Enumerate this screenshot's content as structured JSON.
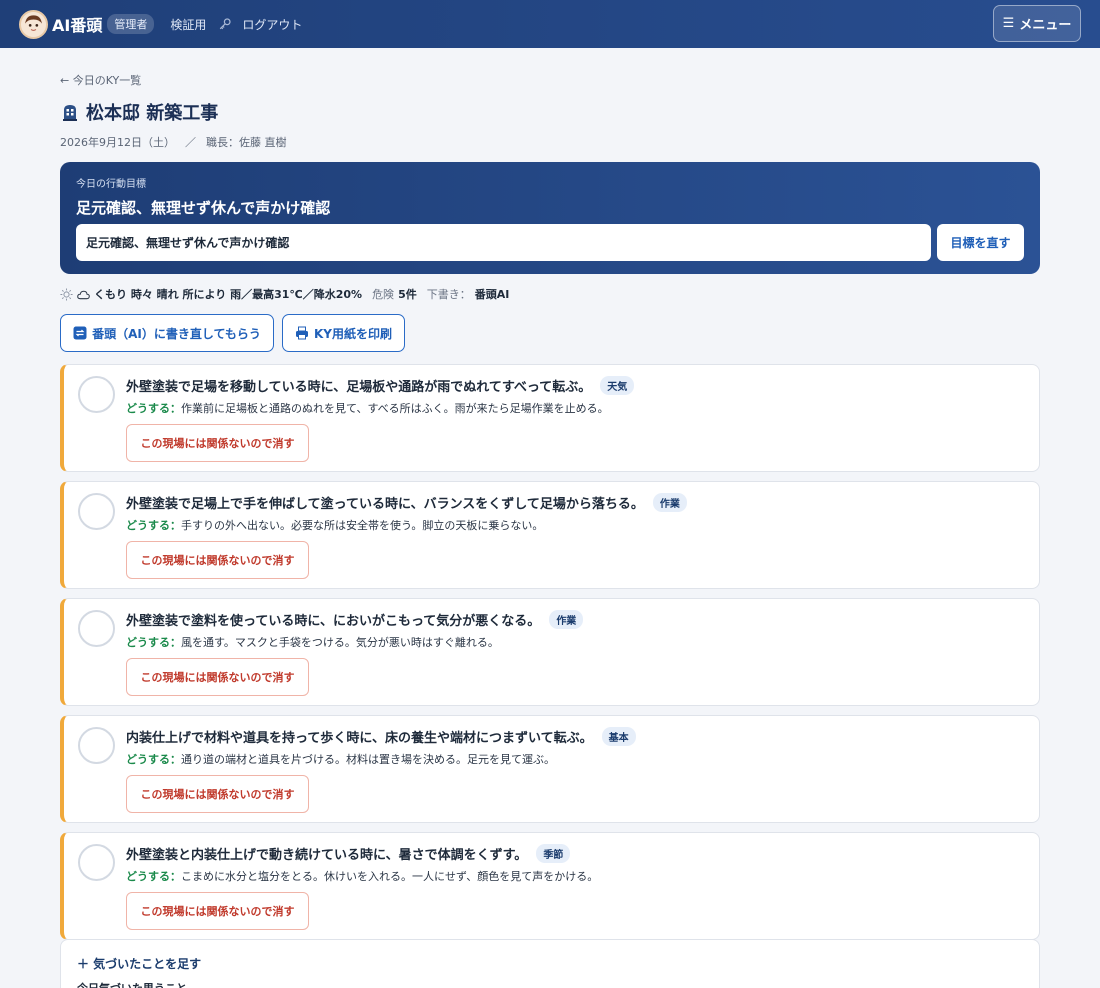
{
  "header": {
    "brand": "AI番頭",
    "role_badge": "管理者",
    "nav_link": "検証用",
    "logout": "ログアウト",
    "menu_label": "メニュー"
  },
  "page": {
    "back_link": "← 今日のKY一覧",
    "title": "松本邸 新築工事",
    "date": "2026年9月12日（土）",
    "separator": "／",
    "foreman": "職長：佐藤 直樹"
  },
  "goal": {
    "label": "今日の行動目標",
    "text": "足元確認、無理せず休んで声かけ確認",
    "input_value": "足元確認、無理せず休んで声かけ確認",
    "button_label": "目標を直す"
  },
  "weather": {
    "summary": "くもり 時々 晴れ 所により 雨／最高31℃／降水20%",
    "risk_label": "危険",
    "risk_count": "5件",
    "draft_label": "下書き：",
    "draft_value": "番頭AI"
  },
  "actions": {
    "rewrite_label": "番頭（AI）に書き直してもらう",
    "print_label": "KY用紙を印刷"
  },
  "how_label": "どうする：",
  "dismiss_label": "この現場には関係ないので消す",
  "risks": [
    {
      "title": "外壁塗装で足場を移動している時に、足場板や通路が雨でぬれてすべって転ぶ。",
      "tag": "天気",
      "how": "作業前に足場板と通路のぬれを見て、すべる所はふく。雨が来たら足場作業を止める。"
    },
    {
      "title": "外壁塗装で足場上で手を伸ばして塗っている時に、バランスをくずして足場から落ちる。",
      "tag": "作業",
      "how": "手すりの外へ出ない。必要な所は安全帯を使う。脚立の天板に乗らない。"
    },
    {
      "title": "外壁塗装で塗料を使っている時に、においがこもって気分が悪くなる。",
      "tag": "作業",
      "how": "風を通す。マスクと手袋をつける。気分が悪い時はすぐ離れる。"
    },
    {
      "title": "内装仕上げで材料や道具を持って歩く時に、床の養生や端材につまずいて転ぶ。",
      "tag": "基本",
      "how": "通り道の端材と道具を片づける。材料は置き場を決める。足元を見て運ぶ。"
    },
    {
      "title": "外壁塗装と内装仕上げで動き続けている時に、暑さで体調をくずす。",
      "tag": "季節",
      "how": "こまめに水分と塩分をとる。休けいを入れる。一人にせず、顔色を見て声をかける。"
    }
  ],
  "add": {
    "title": "＋ 気づいたことを足す",
    "sub": "今日気づいた思うこと"
  }
}
